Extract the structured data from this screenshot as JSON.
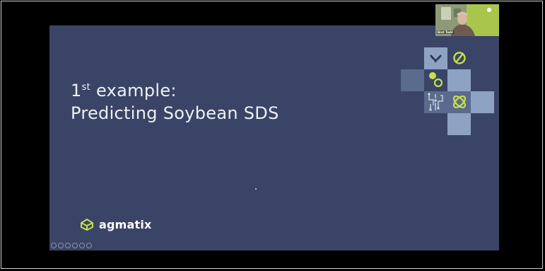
{
  "slide": {
    "title_line1_prefix": "1",
    "title_line1_sup": "st",
    "title_line1_rest": " example:",
    "title_line2": "Predicting Soybean SDS",
    "logo_text": "agmatix"
  },
  "video": {
    "participant_name": "Bret Todd"
  },
  "colors": {
    "slide_bg": "#3a4466",
    "accent": "#c7e04a",
    "tile_light": "#8ea3c4",
    "tile_mid": "#5a6b8e"
  }
}
